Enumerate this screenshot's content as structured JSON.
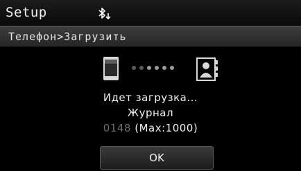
{
  "header": {
    "title": "Setup",
    "status_icon": "bluetooth-download-icon"
  },
  "breadcrumb": {
    "text": "Телефон>Загрузить"
  },
  "main": {
    "source_icon": "phone-icon",
    "target_icon": "contacts-icon",
    "status_text": "Идет загрузка...",
    "item_text": "Журнал",
    "count": "0148",
    "max_text": " (Max:1000)"
  },
  "actions": {
    "ok_label": "OK"
  },
  "colors": {
    "background": "#000000",
    "crumb_bar": "#2f2f2f",
    "dim_text": "#6e6e6e"
  }
}
